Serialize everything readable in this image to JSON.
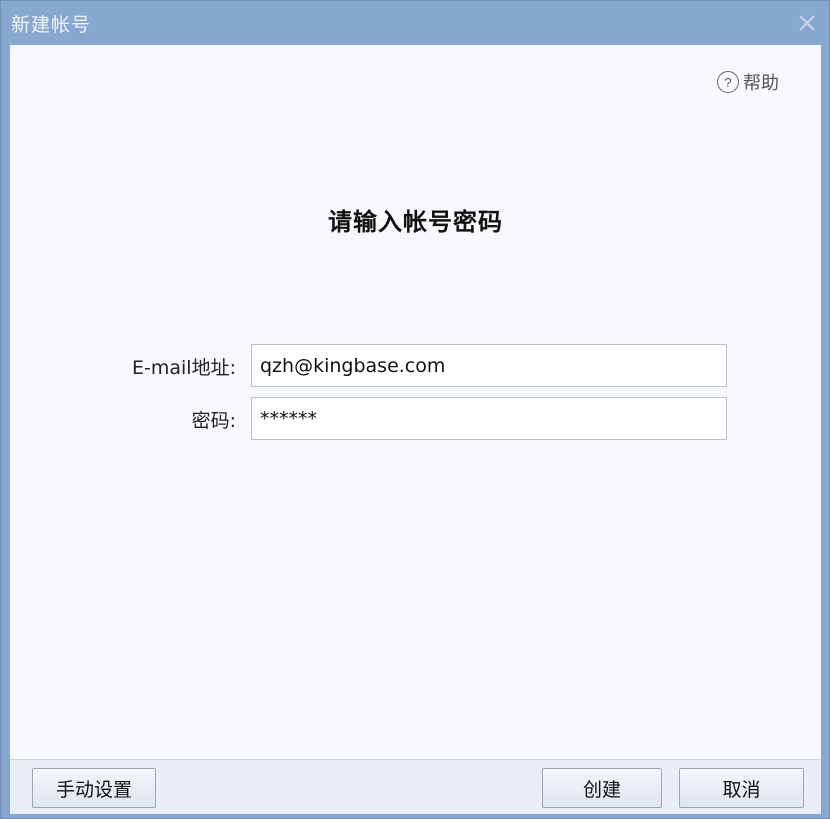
{
  "window": {
    "title": "新建帐号"
  },
  "help": {
    "icon": "?",
    "label": "帮助"
  },
  "heading": "请输入帐号密码",
  "form": {
    "email_label": "E-mail地址:",
    "email_value": "qzh@kingbase.com",
    "password_label": "密码:",
    "password_value": "******"
  },
  "buttons": {
    "manual": "手动设置",
    "create": "创建",
    "cancel": "取消"
  },
  "colors": {
    "titlebar": "#88a7d0",
    "content_bg": "#f6f8fc"
  }
}
